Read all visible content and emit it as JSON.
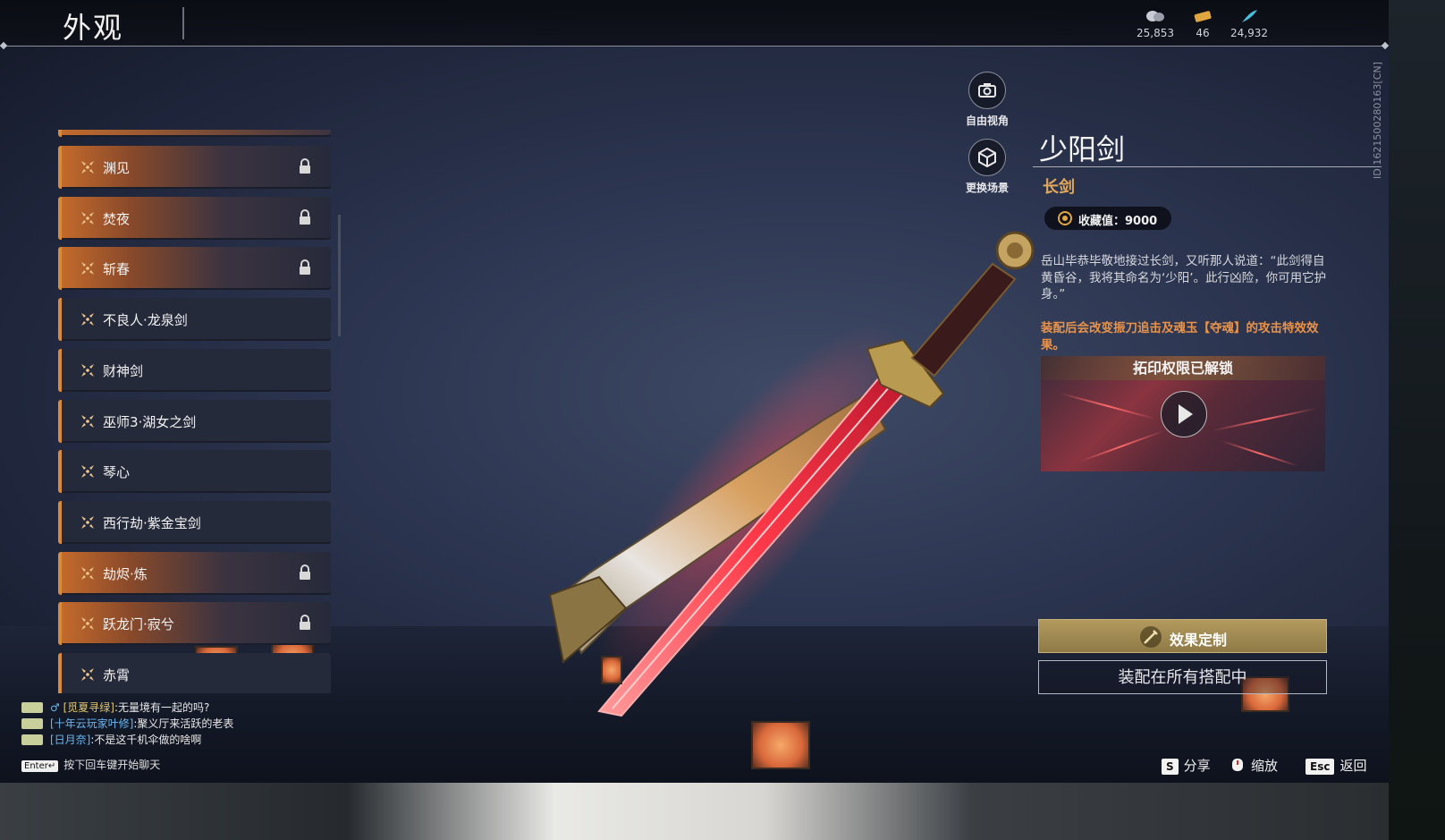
{
  "header": {
    "title": "外观"
  },
  "currencies": [
    {
      "icon": "coin-stack-icon",
      "value": "25,853"
    },
    {
      "icon": "ticket-icon",
      "value": "46"
    },
    {
      "icon": "feather-icon",
      "value": "24,932"
    }
  ],
  "list": {
    "items": [
      {
        "label": "渊见",
        "locked": true
      },
      {
        "label": "焚夜",
        "locked": true
      },
      {
        "label": "斩春",
        "locked": true
      },
      {
        "label": "不良人·龙泉剑",
        "locked": false
      },
      {
        "label": "财神剑",
        "locked": false
      },
      {
        "label": "巫师3·湖女之剑",
        "locked": false
      },
      {
        "label": "琴心",
        "locked": false
      },
      {
        "label": "西行劫·紫金宝剑",
        "locked": false
      },
      {
        "label": "劫烬·炼",
        "locked": true
      },
      {
        "label": "跃龙门·寂兮",
        "locked": true
      },
      {
        "label": "赤霄",
        "locked": false
      }
    ]
  },
  "view_controls": {
    "free_view": "自由视角",
    "change_scene": "更换场景"
  },
  "detail": {
    "name": "少阳剑",
    "type": "长剑",
    "collect_value": "收藏值：9000",
    "description": "岳山毕恭毕敬地接过长剑，又听那人说道：“此剑得自黄昏谷，我将其命名为‘少阳’。此行凶险，你可用它护身。”",
    "effect": "装配后会改变振刀追击及魂玉【夺魂】的攻击特效效果。",
    "video_title": "拓印权限已解锁",
    "custom_button": "效果定制",
    "equip_button": "装配在所有搭配中",
    "id_text": "ID:1621500280163[CN]"
  },
  "chat": {
    "lines": [
      {
        "name": "[觅夏寻绿]",
        "text": ":无量境有一起的吗?"
      },
      {
        "name": "[十年云玩家叶修]",
        "text": ":聚义厅来活跃的老表"
      },
      {
        "name": "[日月奈]",
        "text": ":不是这千机伞做的啥啊"
      }
    ],
    "hint_key": "Enter↵",
    "hint": "按下回车键开始聊天"
  },
  "hotkeys": [
    {
      "key": "S",
      "label": "分享"
    },
    {
      "key": "",
      "label": "缩放"
    },
    {
      "key": "Esc",
      "label": "返回"
    }
  ],
  "colors": {
    "accent_orange": "#d98a3a",
    "effect_text": "#e8924a",
    "type_text": "#e3a85a"
  }
}
